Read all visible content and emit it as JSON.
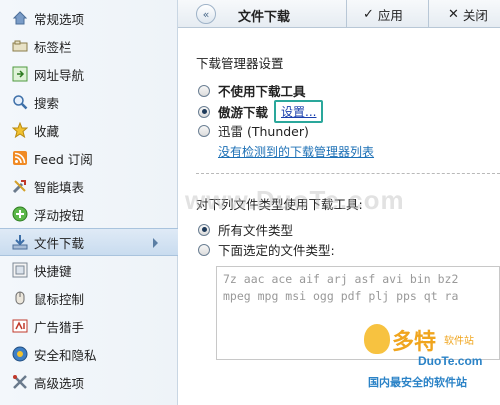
{
  "sidebar": {
    "items": [
      {
        "label": "常规选项",
        "icon": "home-icon",
        "active": false
      },
      {
        "label": "标签栏",
        "icon": "tab-bar-icon",
        "active": false
      },
      {
        "label": "网址导航",
        "icon": "navigation-icon",
        "active": false
      },
      {
        "label": "搜索",
        "icon": "search-icon",
        "active": false
      },
      {
        "label": "收藏",
        "icon": "star-icon",
        "active": false
      },
      {
        "label": "Feed 订阅",
        "icon": "rss-icon",
        "active": false
      },
      {
        "label": "智能填表",
        "icon": "tools-icon",
        "active": false
      },
      {
        "label": "浮动按钮",
        "icon": "plus-circle-icon",
        "active": false
      },
      {
        "label": "文件下载",
        "icon": "download-icon",
        "active": true
      },
      {
        "label": "快捷键",
        "icon": "keyboard-icon",
        "active": false
      },
      {
        "label": "鼠标控制",
        "icon": "mouse-icon",
        "active": false
      },
      {
        "label": "广告猎手",
        "icon": "ad-hunter-icon",
        "active": false
      },
      {
        "label": "安全和隐私",
        "icon": "shield-icon",
        "active": false
      },
      {
        "label": "高级选项",
        "icon": "wrench-icon",
        "active": false
      }
    ]
  },
  "header": {
    "title": "文件下载",
    "apply_label": "应用",
    "close_label": "关闭"
  },
  "download_manager": {
    "section_title": "下载管理器设置",
    "options": [
      {
        "label": "不使用下载工具",
        "selected": false
      },
      {
        "label": "傲游下载",
        "selected": true
      },
      {
        "label": "迅雷 (Thunder)",
        "selected": false
      }
    ],
    "settings_link": "设置...",
    "no_manager_link": "没有检测到的下载管理器列表"
  },
  "filetype": {
    "section_title": "对下列文件类型使用下载工具:",
    "options": [
      {
        "label": "所有文件类型",
        "selected": true
      },
      {
        "label": "下面选定的文件类型:",
        "selected": false
      }
    ],
    "lines": [
      "7z aac ace aif arj asf avi bin bz2",
      "mpeg mpg msi ogg pdf plj pps qt ra"
    ]
  },
  "watermark": {
    "center": "www.DuoTe.com",
    "brand": "多特",
    "brand_small": "软件站",
    "url": "DuoTe.com",
    "tagline": "国内最安全的软件站"
  },
  "colors": {
    "accent": "#2aa79b",
    "link": "#1b6fb5",
    "active_bg": "#c9dcef",
    "watermark_orange": "#f0a51e",
    "watermark_blue": "#2b83c7"
  }
}
